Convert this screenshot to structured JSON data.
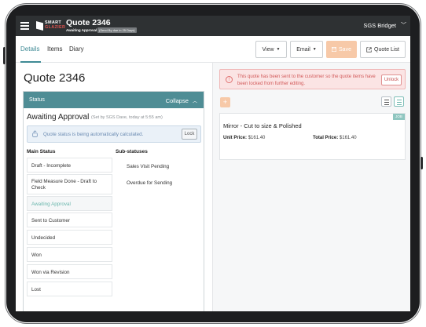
{
  "topbar": {
    "logo_line1": "SMART",
    "logo_line2": "GLAZIER",
    "title": "Quote 2346",
    "status": "Awaiting Approval",
    "badge": "(Send By due in 25 Days)",
    "user": "SGS Bridget",
    "user_caret": "﹀"
  },
  "tabs": [
    {
      "label": "Details",
      "active": true
    },
    {
      "label": "Items",
      "active": false
    },
    {
      "label": "Diary",
      "active": false
    }
  ],
  "toolbar": {
    "view_label": "View",
    "email_label": "Email",
    "save_label": "Save",
    "quote_list_label": "Quote List",
    "save_icon": "save-icon",
    "external_icon": "external-link-icon",
    "colors": {
      "accent": "#3f8a95",
      "save_bg": "#f7c9a8"
    }
  },
  "left": {
    "heading": "Quote 2346",
    "status_panel": {
      "label": "Status",
      "collapse_label": "Collapse",
      "current_status": "Awaiting Approval",
      "set_by": "(Set by SGS Dave, today at 5:55 am)",
      "auto_message": "Quote status is being automatically calculated.",
      "lock_label": "Lock",
      "main_status_header": "Main Status",
      "sub_status_header": "Sub-statuses",
      "main_statuses": [
        {
          "label": "Draft - Incomplete",
          "active": false
        },
        {
          "label": "Field Measure Done - Draft to Check",
          "active": false
        },
        {
          "label": "Awaiting Approval",
          "active": true
        },
        {
          "label": "Sent to Customer",
          "active": false
        },
        {
          "label": "Undecided",
          "active": false
        },
        {
          "label": "Won",
          "active": false
        },
        {
          "label": "Won via Revision",
          "active": false
        },
        {
          "label": "Lost",
          "active": false
        }
      ],
      "sub_statuses": [
        {
          "label": "Sales Visit Pending"
        },
        {
          "label": "Overdue for Sending"
        }
      ]
    }
  },
  "right": {
    "alert_message": "This quote has been sent to the customer so the quote items have been locked from further editing.",
    "unlock_label": "Unlock",
    "add_icon": "plus-icon",
    "items": [
      {
        "badge": "JOB",
        "title": "Mirror - Cut to size & Polished",
        "unit_price_label": "Unit Price:",
        "unit_price": "$161.40",
        "total_price_label": "Total Price:",
        "total_price": "$161.40"
      }
    ]
  }
}
